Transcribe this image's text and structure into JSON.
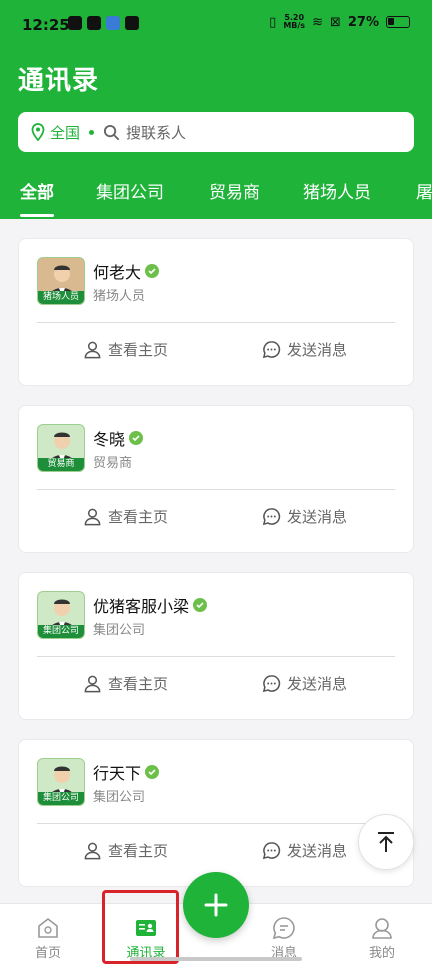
{
  "status": {
    "time": "12:25",
    "speed": "5.20\nMB/s",
    "battery": "27%"
  },
  "page": {
    "title": "通讯录"
  },
  "search": {
    "region": "全国",
    "placeholder": "搜联系人"
  },
  "tabs": [
    "全部",
    "集团公司",
    "贸易商",
    "猪场人员",
    "屠"
  ],
  "contacts": [
    {
      "name": "何老大",
      "role": "猪场人员",
      "badge": "猪场人员"
    },
    {
      "name": "冬晓",
      "role": "贸易商",
      "badge": "贸易商"
    },
    {
      "name": "优猪客服小梁",
      "role": "集团公司",
      "badge": "集团公司"
    },
    {
      "name": "行天下",
      "role": "集团公司",
      "badge": "集团公司"
    }
  ],
  "actions": {
    "view_home": "查看主页",
    "send_message": "发送消息"
  },
  "tabbar": {
    "home": "首页",
    "contacts": "通讯录",
    "messages": "消息",
    "mine": "我的"
  },
  "colors": {
    "brand": "#1fb33a",
    "highlight": "#d8232a"
  }
}
